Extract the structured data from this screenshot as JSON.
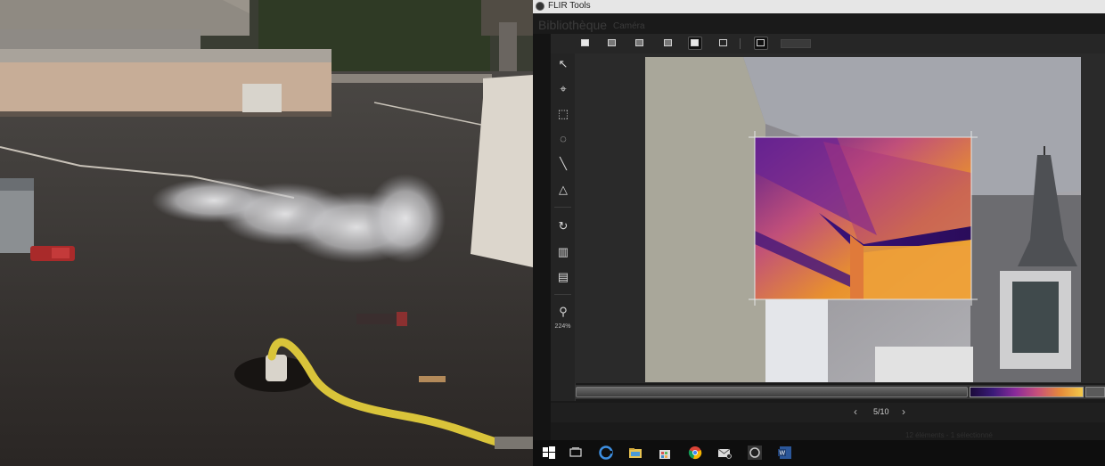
{
  "window": {
    "title": "FLIR Tools"
  },
  "background": {
    "library_label": "Bibliothèque",
    "library_sub": "Caméra",
    "status_text": "12 éléments - 1 sélectionné"
  },
  "toolbar_top": {
    "buttons": [
      {
        "name": "view-single-button",
        "style": "filled"
      },
      {
        "name": "view-ir-button",
        "style": "gray"
      },
      {
        "name": "view-blend-button",
        "style": "gray"
      },
      {
        "name": "view-pip-button",
        "style": "gray"
      },
      {
        "name": "view-msx-button",
        "style": "active"
      },
      {
        "name": "view-photo-button",
        "style": "photo"
      },
      {
        "name": "fit-view-button",
        "style": "active"
      }
    ]
  },
  "left_tools": {
    "items": [
      {
        "name": "select-tool",
        "glyph": "↖"
      },
      {
        "name": "spot-tool",
        "glyph": "⌖"
      },
      {
        "name": "box-tool",
        "glyph": "⬚"
      },
      {
        "name": "circle-tool",
        "glyph": "◌"
      },
      {
        "name": "line-tool",
        "glyph": "╲"
      },
      {
        "name": "polygon-tool",
        "glyph": "△"
      },
      {
        "name": "rotate-tool",
        "glyph": "↻"
      },
      {
        "name": "palette-tool",
        "glyph": "▥"
      },
      {
        "name": "color-distribution-tool",
        "glyph": "▤"
      },
      {
        "name": "zoom-tool",
        "glyph": "⚲"
      }
    ],
    "zoom_level": "224%"
  },
  "pager": {
    "prev": "‹",
    "count": "5/10",
    "next": "›"
  },
  "taskbar": {
    "items": [
      "windows-start-icon",
      "task-view-icon",
      "edge-icon",
      "file-explorer-icon",
      "store-icon",
      "chrome-icon",
      "mail-icon",
      "flir-tools-taskbar-icon",
      "word-icon"
    ]
  },
  "colors": {
    "window_bg": "#1a1a1a",
    "toolbar_bg": "#262626",
    "palette": [
      "#1b0a3a",
      "#3a1a78",
      "#8a2a9a",
      "#c8507a",
      "#e58a3a",
      "#f2c94a"
    ]
  }
}
